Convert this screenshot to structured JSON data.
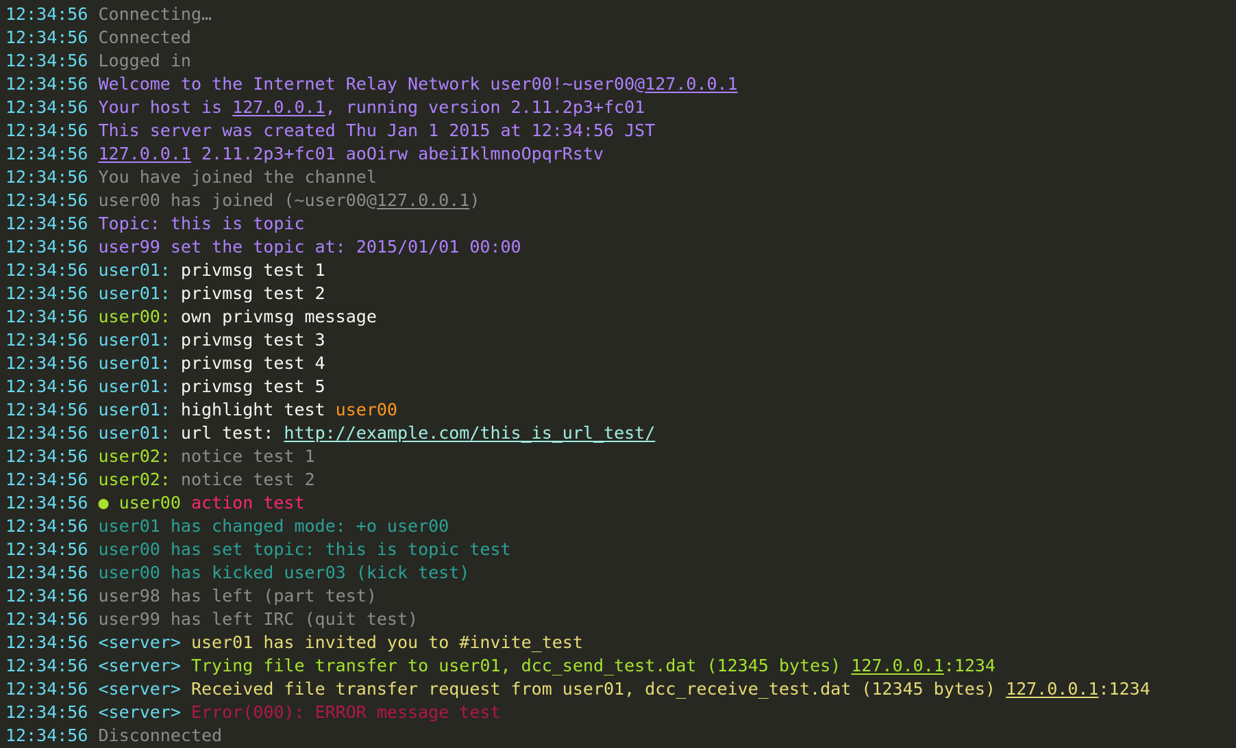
{
  "colors": {
    "background": "#272822",
    "timestamp": "#66d9ef",
    "status": "#8c8c8c",
    "server_info": "#ae81ff",
    "nick": "#66d9ef",
    "own_nick": "#a6e22e",
    "message": "#f8f8f2",
    "highlight": "#fd971f",
    "url": "#a1efe4",
    "notice": "#8c8c8c",
    "action": "#f92672",
    "mode_event": "#2aa198",
    "server_tag": "#66d9ef",
    "invite": "#e6db74",
    "dcc_send": "#a6e22e",
    "error": "#b0174a"
  },
  "lines": [
    {
      "time": "12:34:56",
      "segments": [
        {
          "text": "Connecting…",
          "color": "#8c8c8c"
        }
      ]
    },
    {
      "time": "12:34:56",
      "segments": [
        {
          "text": "Connected",
          "color": "#8c8c8c"
        }
      ]
    },
    {
      "time": "12:34:56",
      "segments": [
        {
          "text": "Logged in",
          "color": "#8c8c8c"
        }
      ]
    },
    {
      "time": "12:34:56",
      "segments": [
        {
          "text": "Welcome to the Internet Relay Network user00!~user00@",
          "color": "#ae81ff"
        },
        {
          "text": "127.0.0.1",
          "color": "#ae81ff",
          "underline": true,
          "link": true
        }
      ]
    },
    {
      "time": "12:34:56",
      "segments": [
        {
          "text": "Your host is ",
          "color": "#ae81ff"
        },
        {
          "text": "127.0.0.1",
          "color": "#ae81ff",
          "underline": true,
          "link": true
        },
        {
          "text": ", running version 2.11.2p3+fc01",
          "color": "#ae81ff"
        }
      ]
    },
    {
      "time": "12:34:56",
      "segments": [
        {
          "text": "This server was created Thu Jan 1 2015 at 12:34:56 JST",
          "color": "#ae81ff"
        }
      ]
    },
    {
      "time": "12:34:56",
      "segments": [
        {
          "text": "127.0.0.1",
          "color": "#ae81ff",
          "underline": true,
          "link": true
        },
        {
          "text": " 2.11.2p3+fc01 aoOirw abeiIklmnoOpqrRstv",
          "color": "#ae81ff"
        }
      ]
    },
    {
      "time": "12:34:56",
      "segments": [
        {
          "text": "You have joined the channel",
          "color": "#8c8c8c"
        }
      ]
    },
    {
      "time": "12:34:56",
      "segments": [
        {
          "text": "user00 has joined (~user00@",
          "color": "#8c8c8c"
        },
        {
          "text": "127.0.0.1",
          "color": "#8c8c8c",
          "underline": true,
          "link": true
        },
        {
          "text": ")",
          "color": "#8c8c8c"
        }
      ]
    },
    {
      "time": "12:34:56",
      "segments": [
        {
          "text": "Topic: this is topic",
          "color": "#ae81ff"
        }
      ]
    },
    {
      "time": "12:34:56",
      "segments": [
        {
          "text": "user99 set the topic at: 2015/01/01 00:00",
          "color": "#ae81ff"
        }
      ]
    },
    {
      "time": "12:34:56",
      "segments": [
        {
          "text": "user01:",
          "color": "#66d9ef"
        },
        {
          "text": " privmsg test 1",
          "color": "#f8f8f2"
        }
      ]
    },
    {
      "time": "12:34:56",
      "segments": [
        {
          "text": "user01:",
          "color": "#66d9ef"
        },
        {
          "text": " privmsg test 2",
          "color": "#f8f8f2"
        }
      ]
    },
    {
      "time": "12:34:56",
      "segments": [
        {
          "text": "user00:",
          "color": "#a6e22e"
        },
        {
          "text": " own privmsg message",
          "color": "#f8f8f2"
        }
      ]
    },
    {
      "time": "12:34:56",
      "segments": [
        {
          "text": "user01:",
          "color": "#66d9ef"
        },
        {
          "text": " privmsg test 3",
          "color": "#f8f8f2"
        }
      ]
    },
    {
      "time": "12:34:56",
      "segments": [
        {
          "text": "user01:",
          "color": "#66d9ef"
        },
        {
          "text": " privmsg test 4",
          "color": "#f8f8f2"
        }
      ]
    },
    {
      "time": "12:34:56",
      "segments": [
        {
          "text": "user01:",
          "color": "#66d9ef"
        },
        {
          "text": " privmsg test 5",
          "color": "#f8f8f2"
        }
      ]
    },
    {
      "time": "12:34:56",
      "segments": [
        {
          "text": "user01:",
          "color": "#66d9ef"
        },
        {
          "text": " highlight test ",
          "color": "#f8f8f2"
        },
        {
          "text": "user00",
          "color": "#fd971f"
        }
      ]
    },
    {
      "time": "12:34:56",
      "segments": [
        {
          "text": "user01:",
          "color": "#66d9ef"
        },
        {
          "text": " url test: ",
          "color": "#f8f8f2"
        },
        {
          "text": "http://example.com/this_is_url_test/",
          "color": "#a1efe4",
          "underline": true,
          "link": true
        }
      ]
    },
    {
      "time": "12:34:56",
      "segments": [
        {
          "text": "user02:",
          "color": "#a6e22e"
        },
        {
          "text": " notice test 1",
          "color": "#8c8c8c"
        }
      ]
    },
    {
      "time": "12:34:56",
      "segments": [
        {
          "text": "user02:",
          "color": "#a6e22e"
        },
        {
          "text": " notice test 2",
          "color": "#8c8c8c"
        }
      ]
    },
    {
      "time": "12:34:56",
      "segments": [
        {
          "text": "● user00",
          "color": "#a6e22e"
        },
        {
          "text": " action test",
          "color": "#f92672"
        }
      ]
    },
    {
      "time": "12:34:56",
      "segments": [
        {
          "text": "user01 has changed mode: +o user00",
          "color": "#2aa198"
        }
      ]
    },
    {
      "time": "12:34:56",
      "segments": [
        {
          "text": "user00 has set topic: this is topic test",
          "color": "#2aa198"
        }
      ]
    },
    {
      "time": "12:34:56",
      "segments": [
        {
          "text": "user00 has kicked user03 (kick test)",
          "color": "#2aa198"
        }
      ]
    },
    {
      "time": "12:34:56",
      "segments": [
        {
          "text": "user98 has left (part test)",
          "color": "#8c8c8c"
        }
      ]
    },
    {
      "time": "12:34:56",
      "segments": [
        {
          "text": "user99 has left IRC (quit test)",
          "color": "#8c8c8c"
        }
      ]
    },
    {
      "time": "12:34:56",
      "segments": [
        {
          "text": "<server>",
          "color": "#66d9ef"
        },
        {
          "text": " user01 has invited you to #invite_test",
          "color": "#e6db74"
        }
      ]
    },
    {
      "time": "12:34:56",
      "segments": [
        {
          "text": "<server>",
          "color": "#66d9ef"
        },
        {
          "text": " Trying file transfer to user01, dcc_send_test.dat (12345 bytes) ",
          "color": "#a6e22e"
        },
        {
          "text": "127.0.0.1",
          "color": "#a6e22e",
          "underline": true,
          "link": true
        },
        {
          "text": ":1234",
          "color": "#a6e22e"
        }
      ]
    },
    {
      "time": "12:34:56",
      "segments": [
        {
          "text": "<server>",
          "color": "#66d9ef"
        },
        {
          "text": " Received file transfer request from user01, dcc_receive_test.dat (12345 bytes) ",
          "color": "#e6db74"
        },
        {
          "text": "127.0.0.1",
          "color": "#e6db74",
          "underline": true,
          "link": true
        },
        {
          "text": ":1234",
          "color": "#e6db74"
        }
      ]
    },
    {
      "time": "12:34:56",
      "segments": [
        {
          "text": "<server>",
          "color": "#66d9ef"
        },
        {
          "text": " Error(000): ERROR message test",
          "color": "#b0174a"
        }
      ]
    },
    {
      "time": "12:34:56",
      "segments": [
        {
          "text": "Disconnected",
          "color": "#8c8c8c"
        }
      ]
    }
  ]
}
